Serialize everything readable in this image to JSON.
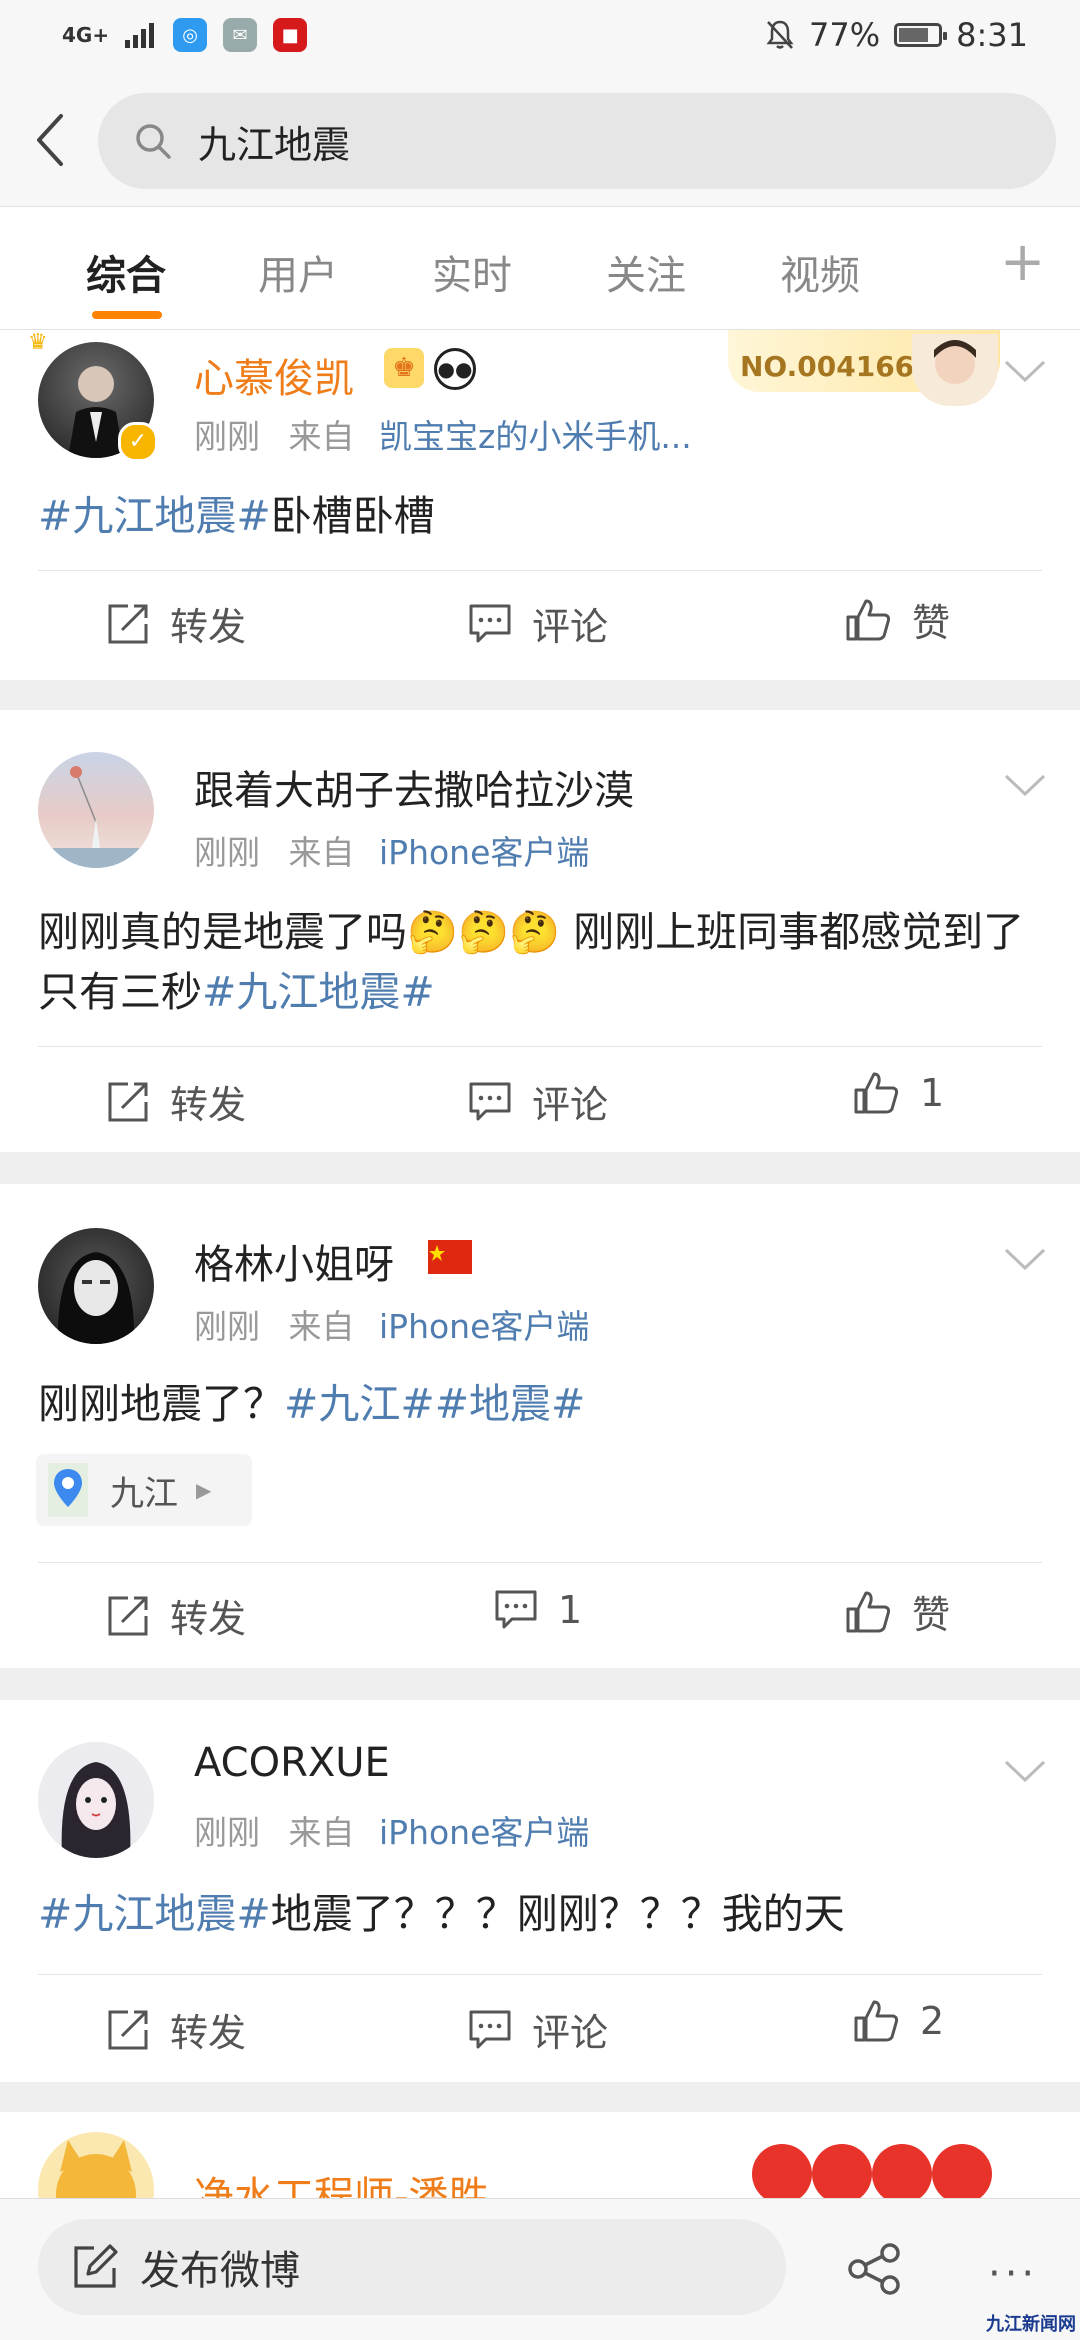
{
  "status_bar": {
    "network": "4G+",
    "battery": "77%",
    "battery_level": 0.77,
    "time": "8:31"
  },
  "search": {
    "query": "九江地震"
  },
  "tabs": [
    {
      "label": "综合"
    },
    {
      "label": "用户"
    },
    {
      "label": "实时"
    },
    {
      "label": "关注"
    },
    {
      "label": "视频"
    }
  ],
  "tab_add": "+",
  "posts": [
    {
      "user": "心慕俊凯",
      "time": "刚刚",
      "from": "来自",
      "source": "凯宝宝z的小米手机...",
      "fans_no": "NO.0041669",
      "content_tag": "#九江地震#",
      "content_text": "卧槽卧槽",
      "repost": "转发",
      "comment": "评论",
      "like": "赞"
    },
    {
      "user": "跟着大胡子去撒哈拉沙漠",
      "time": "刚刚",
      "from": "来自",
      "source": "iPhone客户端",
      "content_text": "刚刚真的是地震了吗🤔🤔🤔 刚刚上班同事都感觉到了 只有三秒",
      "content_tag": "#九江地震#",
      "repost": "转发",
      "comment": "评论",
      "like": "1"
    },
    {
      "user": "格林小姐呀",
      "time": "刚刚",
      "from": "来自",
      "source": "iPhone客户端",
      "content_text": "刚刚地震了？",
      "content_tag": "#九江##地震#",
      "location": "九江",
      "repost": "转发",
      "comment": "1",
      "like": "赞"
    },
    {
      "user": "ACORXUE",
      "time": "刚刚",
      "from": "来自",
      "source": "iPhone客户端",
      "content_tag": "#九江地震#",
      "content_text": "地震了？？？刚刚？？？我的天",
      "repost": "转发",
      "comment": "评论",
      "like": "2"
    },
    {
      "user": "净水工程师-潘胜"
    }
  ],
  "bottom_bar": {
    "compose_label": "发布微博",
    "more": "···"
  },
  "watermark": "九江新闻网",
  "colors": {
    "accent": "#ff8200",
    "link": "#507daf",
    "username_orange": "#ef7d1a"
  }
}
